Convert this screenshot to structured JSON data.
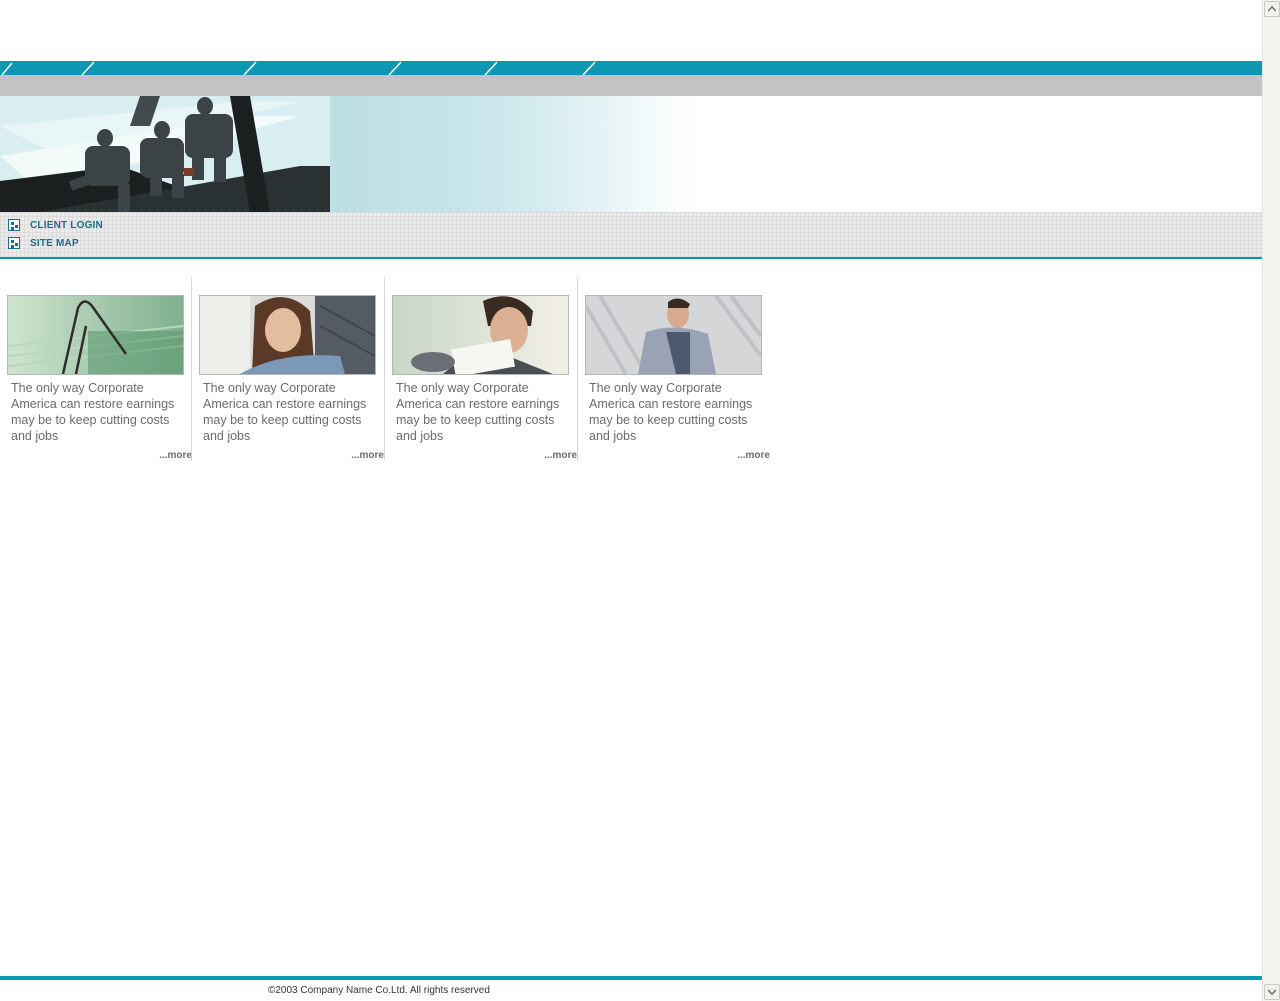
{
  "links": [
    {
      "label": "CLIENT LOGIN"
    },
    {
      "label": "SITE MAP"
    }
  ],
  "cards": [
    {
      "text": "The only way Corporate America can restore earnings may be to keep cutting costs and jobs",
      "more": "...more",
      "photo": "paperclip-photo"
    },
    {
      "text": "The only way Corporate America can restore earnings may be to keep cutting costs and jobs",
      "more": "...more",
      "photo": "woman-photo"
    },
    {
      "text": "The only way Corporate America can restore earnings may be to keep cutting costs and jobs",
      "more": "...more",
      "photo": "man-reading-photo"
    },
    {
      "text": "The only way Corporate America can restore earnings may be to keep cutting costs and jobs",
      "more": "...more",
      "photo": "man-standing-photo"
    }
  ],
  "footer": {
    "copyright": "©2003 Company Name Co.Ltd. All rights reserved"
  },
  "colors": {
    "accent": "#0e97b2",
    "link": "#1a6f86",
    "body_text": "#6b6b6b",
    "strip": "#c3c3c3"
  },
  "icons": [
    "grid-bullet-icon",
    "scroll-up-arrow-icon",
    "scroll-down-arrow-icon"
  ]
}
